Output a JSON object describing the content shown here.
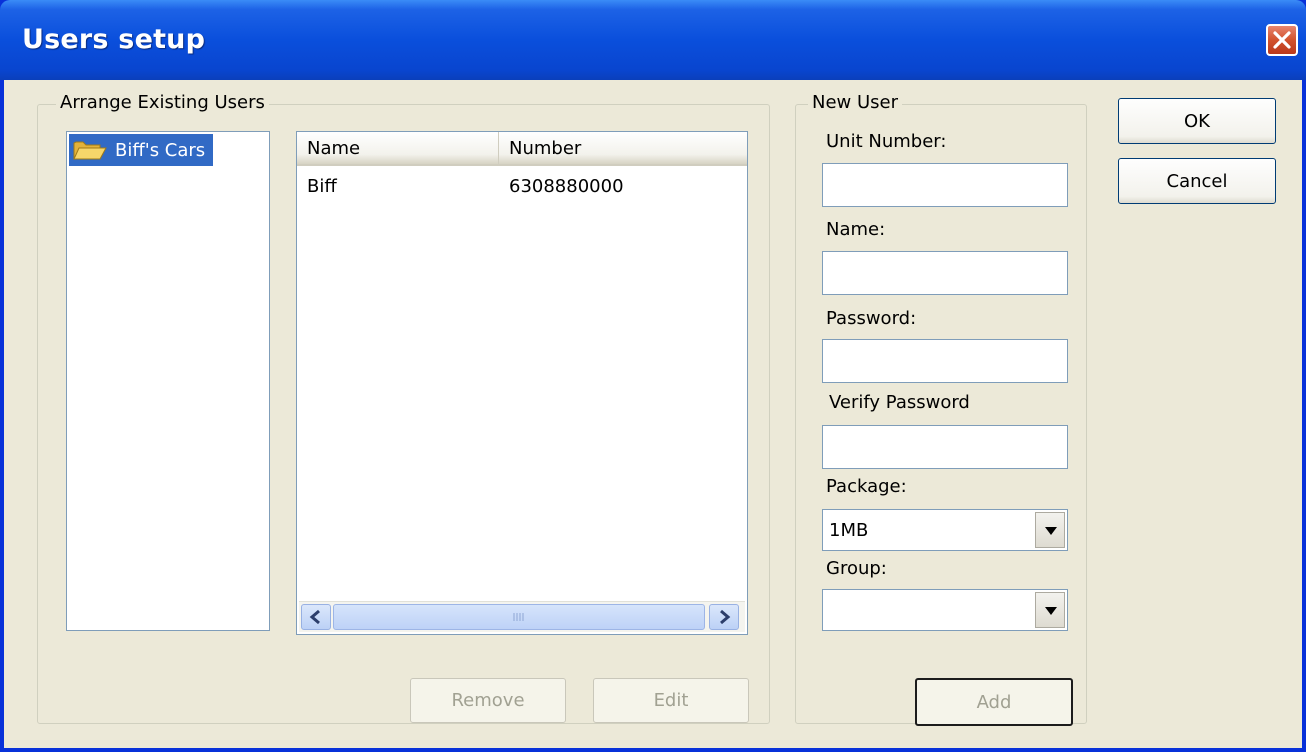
{
  "window": {
    "title": "Users setup"
  },
  "arrange": {
    "legend": "Arrange Existing Users",
    "tree": [
      {
        "label": "Biff's Cars",
        "icon": "folder-icon",
        "selected": true
      }
    ],
    "columns": [
      "Name",
      "Number"
    ],
    "rows": [
      {
        "name": "Biff",
        "number": "6308880000"
      }
    ],
    "remove_label": "Remove",
    "edit_label": "Edit"
  },
  "new_user": {
    "legend": "New User",
    "unit_number_label": "Unit Number:",
    "unit_number_value": "",
    "name_label": "Name:",
    "name_value": "",
    "password_label": "Password:",
    "password_value": "",
    "verify_label": "Verify Password",
    "verify_value": "",
    "package_label": "Package:",
    "package_value": "1MB",
    "group_label": "Group:",
    "group_value": "",
    "add_label": "Add"
  },
  "buttons": {
    "ok": "OK",
    "cancel": "Cancel"
  },
  "colors": {
    "title_bar": "#0a4fdc",
    "selection": "#316ac5",
    "client": "#ece9d8",
    "close": "#d2522d"
  }
}
